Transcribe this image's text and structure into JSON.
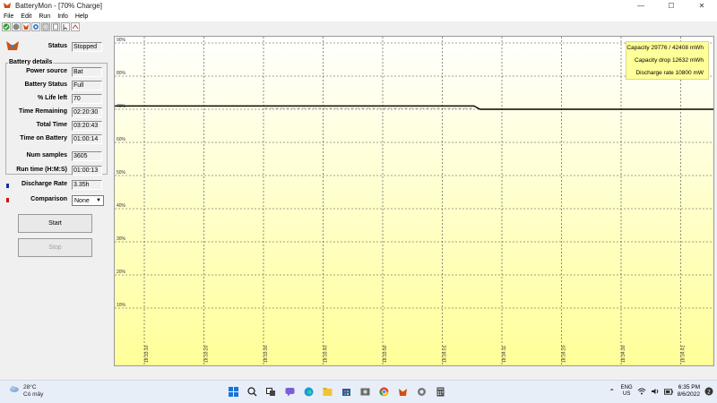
{
  "window": {
    "title": "BatteryMon - [70% Charge]",
    "minimize": "—",
    "maximize": "☐",
    "close": "✕"
  },
  "menu": [
    "File",
    "Edit",
    "Run",
    "Info",
    "Help"
  ],
  "toolbar_icons": [
    "check-icon",
    "record-icon",
    "battery-icon",
    "settings-icon",
    "info-icon",
    "doc-icon",
    "pointer-icon",
    "arrow-icon"
  ],
  "status": {
    "label": "Status",
    "value": "Stopped"
  },
  "battery_details": {
    "title": "Battery details",
    "rows": [
      {
        "label": "Power source",
        "value": "Bat"
      },
      {
        "label": "Battery Status",
        "value": "Full"
      },
      {
        "label": "% Life left",
        "value": "70"
      },
      {
        "label": "Time Remaining",
        "value": "02:20:30"
      },
      {
        "label": "Total Time",
        "value": "03:20:43"
      },
      {
        "label": "Time on Battery",
        "value": "01:00:14"
      }
    ]
  },
  "stats": [
    {
      "label": "Num samples",
      "value": "3605"
    },
    {
      "label": "Run time (H:M:S)",
      "value": "01:00:13"
    },
    {
      "label": "Discharge Rate",
      "value": "3.35h"
    }
  ],
  "comparison": {
    "label": "Comparison",
    "selected": "None"
  },
  "buttons": {
    "start": "Start",
    "stop": "Stop"
  },
  "info_box": {
    "capacity": "Capacity 29776 / 42408 mWh",
    "drop": "Capacity drop 12632 mWh",
    "rate": "Discharge rate 10800 mW"
  },
  "colors": {
    "chart_top": "#ffffff",
    "chart_bottom": "#ffff99",
    "line": "#000000",
    "comparison_line": "#888888",
    "marker_blue": "#1030a0",
    "marker_red": "#d01010"
  },
  "chart_data": {
    "type": "line",
    "ytick_labels": [
      "90%",
      "80%",
      "70%",
      "60%",
      "50%",
      "40%",
      "30%",
      "20%",
      "10%"
    ],
    "xtick_labels": [
      "18:33:10",
      "18:33:20",
      "18:33:30",
      "18:33:40",
      "18:33:50",
      "18:34:01",
      "18:34:11",
      "18:34:20",
      "18:34:30",
      "18:34:41"
    ],
    "ylim": [
      0,
      100
    ],
    "grid": true,
    "series": [
      {
        "values": [
          [
            0,
            71
          ],
          [
            0.6,
            71
          ],
          [
            0.61,
            70
          ],
          [
            1,
            70
          ]
        ]
      },
      {
        "values": [
          [
            0.25,
            70.3
          ],
          [
            0.6,
            70.3
          ]
        ],
        "style": "dashed"
      }
    ]
  },
  "taskbar": {
    "weather_temp": "28°C",
    "weather_desc": "Có mây",
    "icons": [
      "windows-start-icon",
      "search-icon",
      "task-view-icon",
      "chat-icon",
      "edge-icon",
      "file-explorer-icon",
      "store-icon",
      "photos-icon",
      "chrome-icon",
      "batterymon-icon",
      "settings-icon",
      "calculator-icon"
    ],
    "lang_top": "ENG",
    "lang_bottom": "US",
    "time": "6:35 PM",
    "date": "8/6/2022"
  }
}
